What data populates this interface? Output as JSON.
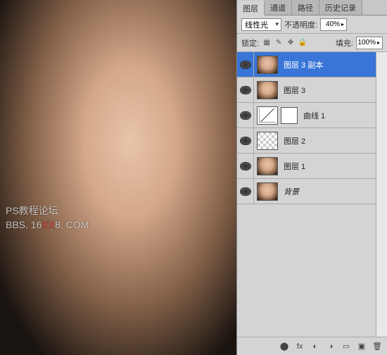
{
  "watermark": {
    "line1": "PS教程论坛",
    "line2_a": "BBS. 16",
    "line2_b": "XX",
    "line2_c": "8. COM"
  },
  "tabs": [
    "图层",
    "通道",
    "路径",
    "历史记录"
  ],
  "blend_mode": "线性光",
  "opacity_label": "不透明度:",
  "opacity_value": "40%",
  "lock_label": "锁定:",
  "fill_label": "填充:",
  "fill_value": "100%",
  "lock_icons": {
    "transparent": "▦",
    "brush": "✎",
    "move": "✥",
    "all": "🔒"
  },
  "layers": [
    {
      "name": "图层 3 副本",
      "type": "face",
      "selected": true
    },
    {
      "name": "图层 3",
      "type": "face"
    },
    {
      "name": "曲线 1",
      "type": "curves",
      "mask": true
    },
    {
      "name": "图层 2",
      "type": "checker"
    },
    {
      "name": "图层 1",
      "type": "face"
    },
    {
      "name": "背景",
      "type": "face",
      "bg": true
    }
  ],
  "bottom_icons": {
    "link": "⬤",
    "fx": "fx",
    "mask": "◐",
    "adjust": "◑",
    "group": "▭",
    "new": "▣",
    "trash": "🗑"
  }
}
